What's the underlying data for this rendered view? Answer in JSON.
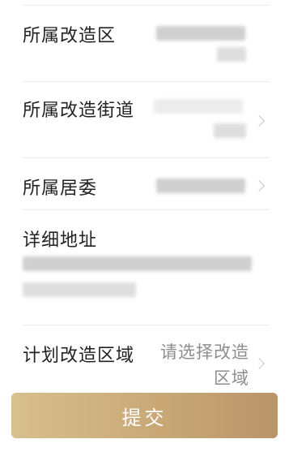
{
  "form": {
    "district": {
      "label": "所属改造区",
      "value": ""
    },
    "street": {
      "label": "所属改造街道",
      "value": ""
    },
    "committee": {
      "label": "所属居委",
      "value": ""
    },
    "address": {
      "label": "详细地址",
      "value": ""
    },
    "plan_area": {
      "label": "计划改造区域",
      "placeholder_line1": "请选择改造",
      "placeholder_line2": "区域"
    }
  },
  "submit_button": {
    "label": "提交"
  },
  "colors": {
    "button_gradient_start": "#d7c08d",
    "button_gradient_end": "#b8956a",
    "label": "#222222",
    "placeholder": "#8d8d8d",
    "divider": "#ececec"
  }
}
